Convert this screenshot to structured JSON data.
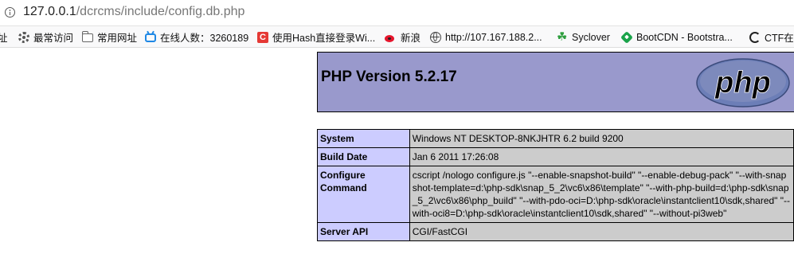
{
  "addressbar": {
    "url_host": "127.0.0.1",
    "url_path": "/dcrcms/include/config.db.php"
  },
  "bookmarks": [
    {
      "label": "址",
      "icon": "none"
    },
    {
      "label": "最常访问",
      "icon": "gear-icon"
    },
    {
      "label": "常用网址",
      "icon": "folder-icon"
    },
    {
      "label": "在线人数：3260189",
      "icon": "bilibili-icon"
    },
    {
      "label": "使用Hash直接登录Wi...",
      "icon": "csdn-icon"
    },
    {
      "label": "新浪",
      "icon": "weibo-icon"
    },
    {
      "label": "http://107.167.188.2...",
      "icon": "globe-icon"
    },
    {
      "label": "Syclover",
      "icon": "clover-icon"
    },
    {
      "label": "BootCDN - Bootstra...",
      "icon": "bootcdn-icon"
    },
    {
      "label": "CTF在",
      "icon": "ctf-icon"
    }
  ],
  "phpinfo": {
    "title": "PHP Version 5.2.17",
    "logo_text": "php",
    "rows": [
      {
        "key": "System",
        "value": "Windows NT DESKTOP-8NKJHTR 6.2 build 9200"
      },
      {
        "key": "Build Date",
        "value": "Jan 6 2011 17:26:08"
      },
      {
        "key": "Configure Command",
        "value": "cscript /nologo configure.js \"--enable-snapshot-build\" \"--enable-debug-pack\" \"--with-snapshot-template=d:\\php-sdk\\snap_5_2\\vc6\\x86\\template\" \"--with-php-build=d:\\php-sdk\\snap_5_2\\vc6\\x86\\php_build\" \"--with-pdo-oci=D:\\php-sdk\\oracle\\instantclient10\\sdk,shared\" \"--with-oci8=D:\\php-sdk\\oracle\\instantclient10\\sdk,shared\" \"--without-pi3web\""
      },
      {
        "key": "Server API",
        "value": "CGI/FastCGI"
      }
    ]
  },
  "colors": {
    "header_bg": "#9999cc",
    "key_bg": "#ccccff",
    "value_bg": "#cccccc",
    "logo_bg": "#6c7eb7"
  }
}
